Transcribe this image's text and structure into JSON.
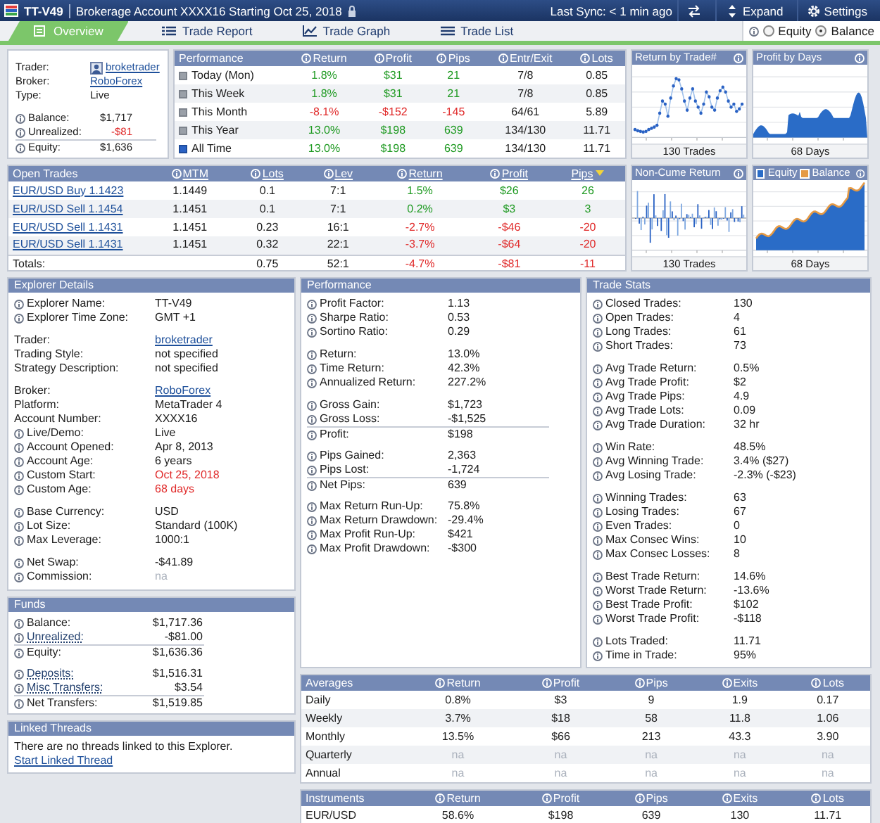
{
  "header": {
    "title": "TT-V49",
    "subtitle": "Brokerage Account XXXX16 Starting Oct 25, 2018",
    "sync": "Last Sync: < 1 min ago",
    "buttons": [
      {
        "kind": "swap"
      },
      {
        "kind": "expand",
        "label": "Expand"
      },
      {
        "kind": "settings",
        "label": "Settings"
      }
    ]
  },
  "tabs": [
    {
      "label": "Overview",
      "kind": "overview",
      "selected": true
    },
    {
      "label": "Trade Report",
      "kind": "report",
      "selected": false
    },
    {
      "label": "Trade Graph",
      "kind": "graph",
      "selected": false
    },
    {
      "label": "Trade List",
      "kind": "list",
      "selected": false
    }
  ],
  "view_toggle": [
    {
      "label": "Equity",
      "selected": false
    },
    {
      "label": "Balance",
      "selected": true
    }
  ],
  "summary": {
    "groups": [
      [
        {
          "label": "Trader:",
          "value": "broketrader",
          "kind": "link",
          "avatar": true
        },
        {
          "label": "Broker:",
          "value": "RoboForex",
          "kind": "link"
        },
        {
          "label": "Type:",
          "value": "Live",
          "kind": "text"
        }
      ],
      [
        {
          "label": "Balance:",
          "value": "$1,717",
          "kind": "text",
          "info": true
        },
        {
          "label": "Unrealized:",
          "value": "-$81",
          "kind": "down",
          "info": true
        },
        {
          "label": "Equity:",
          "value": "$1,636",
          "kind": "text",
          "info": true,
          "total": true
        }
      ]
    ]
  },
  "performance_table": {
    "title": "Performance",
    "columns": [
      {
        "label": "Return",
        "info": true,
        "colored": true
      },
      {
        "label": "Profit",
        "info": true,
        "colored": true
      },
      {
        "label": "Pips",
        "info": true,
        "colored": true
      },
      {
        "label": "Entr/Exit",
        "info": true
      },
      {
        "label": "Lots",
        "info": true
      }
    ],
    "rows": [
      {
        "label": "Today (Mon)",
        "selected": false,
        "kind": "gain",
        "cells": [
          "1.8%",
          "$31",
          "21",
          "7/8",
          "0.85"
        ]
      },
      {
        "label": "This Week",
        "selected": false,
        "kind": "gain",
        "cells": [
          "1.8%",
          "$31",
          "21",
          "7/8",
          "0.85"
        ]
      },
      {
        "label": "This Month",
        "selected": false,
        "kind": "loss",
        "cells": [
          "-8.1%",
          "-$152",
          "-145",
          "64/61",
          "5.89"
        ]
      },
      {
        "label": "This Year",
        "selected": false,
        "kind": "gain",
        "cells": [
          "13.0%",
          "$198",
          "639",
          "134/130",
          "11.71"
        ]
      },
      {
        "label": "All Time",
        "selected": true,
        "kind": "gain",
        "cells": [
          "13.0%",
          "$198",
          "639",
          "134/130",
          "11.71"
        ]
      }
    ]
  },
  "open_trades": {
    "title": "Open Trades",
    "columns": [
      {
        "label": "MTM",
        "info": true,
        "link": true
      },
      {
        "label": "Lots",
        "info": true,
        "link": true
      },
      {
        "label": "Lev",
        "info": true,
        "link": true
      },
      {
        "label": "Return",
        "info": true,
        "link": true,
        "colored": true
      },
      {
        "label": "Profit",
        "info": true,
        "link": true,
        "colored": true
      },
      {
        "label": "Pips",
        "link": true,
        "colored": true,
        "sorted": true
      }
    ],
    "rows": [
      {
        "label": "EUR/USD Buy 1.1423",
        "kind": "gain",
        "cells": [
          "1.1449",
          "0.1",
          "7:1",
          "1.5%",
          "$26",
          "26"
        ]
      },
      {
        "label": "EUR/USD Sell 1.1454",
        "kind": "gain",
        "cells": [
          "1.1451",
          "0.1",
          "7:1",
          "0.2%",
          "$3",
          "3"
        ]
      },
      {
        "label": "EUR/USD Sell 1.1431",
        "kind": "loss",
        "cells": [
          "1.1451",
          "0.23",
          "16:1",
          "-2.7%",
          "-$46",
          "-20"
        ]
      },
      {
        "label": "EUR/USD Sell 1.1431",
        "kind": "loss",
        "cells": [
          "1.1451",
          "0.32",
          "22:1",
          "-3.7%",
          "-$64",
          "-20"
        ]
      }
    ],
    "totals": {
      "label": "Totals:",
      "kind": "loss",
      "cells": [
        null,
        "0.75",
        "52:1",
        "-4.7%",
        "-$81",
        "-11"
      ]
    }
  },
  "charts": [
    {
      "title": "Return by Trade#",
      "kind": "scatter",
      "footer": "130 Trades"
    },
    {
      "title": "Profit by Days",
      "kind": "area",
      "footer": "68 Days"
    },
    {
      "title": "Non-Cume Return",
      "kind": "bars",
      "footer": "130 Trades"
    },
    {
      "legend": [
        {
          "label": "Equity",
          "color": "#2a6cc7"
        },
        {
          "label": "Balance",
          "color": "#e59a45"
        }
      ],
      "kind": "equity",
      "footer": "68 Days"
    }
  ],
  "explorer_details": {
    "title": "Explorer Details",
    "groups": [
      [
        {
          "label": "Explorer Name:",
          "value": "TT-V49",
          "kind": "text",
          "info": true
        },
        {
          "label": "Explorer Time Zone:",
          "value": "GMT +1",
          "kind": "text",
          "info": true
        }
      ],
      [
        {
          "label": "Trader:",
          "value": "broketrader",
          "kind": "link"
        },
        {
          "label": "Trading Style:",
          "value": "not specified",
          "kind": "text"
        },
        {
          "label": "Strategy Description:",
          "value": "not specified",
          "kind": "text"
        }
      ],
      [
        {
          "label": "Broker:",
          "value": "RoboForex",
          "kind": "link"
        },
        {
          "label": "Platform:",
          "value": "MetaTrader 4",
          "kind": "text"
        },
        {
          "label": "Account Number:",
          "value": "XXXX16",
          "kind": "text"
        },
        {
          "label": "Live/Demo:",
          "value": "Live",
          "kind": "text",
          "info": true
        },
        {
          "label": "Account Opened:",
          "value": "Apr 8, 2013",
          "kind": "text",
          "info": true
        },
        {
          "label": "Account Age:",
          "value": "6 years",
          "kind": "text",
          "info": true
        },
        {
          "label": "Custom Start:",
          "value": "Oct 25, 2018",
          "kind": "alert",
          "info": true
        },
        {
          "label": "Custom Age:",
          "value": "68 days",
          "kind": "alert",
          "info": true
        }
      ],
      [
        {
          "label": "Base Currency:",
          "value": "USD",
          "kind": "text",
          "info": true
        },
        {
          "label": "Lot Size:",
          "value": "Standard (100K)",
          "kind": "text",
          "info": true
        },
        {
          "label": "Max Leverage:",
          "value": "1000:1",
          "kind": "text",
          "info": true
        }
      ],
      [
        {
          "label": "Net Swap:",
          "value": "-$41.89",
          "kind": "text",
          "info": true
        },
        {
          "label": "Commission:",
          "value": "na",
          "kind": "na",
          "info": true
        }
      ]
    ]
  },
  "funds": {
    "title": "Funds",
    "groups": [
      [
        {
          "label": "Balance:",
          "value": "$1,717.36",
          "kind": "text",
          "info": true
        },
        {
          "label": "Unrealized:",
          "value": "-$81.00",
          "kind": "text",
          "info": true,
          "label_link": true
        },
        {
          "label": "Equity:",
          "value": "$1,636.36",
          "kind": "text",
          "info": true,
          "total": true
        }
      ],
      [
        {
          "label": "Deposits:",
          "value": "$1,516.31",
          "kind": "text",
          "info": true,
          "label_link": true
        },
        {
          "label": "Misc Transfers:",
          "value": "$3.54",
          "kind": "text",
          "info": true,
          "label_link": true
        },
        {
          "label": "Net Transfers:",
          "value": "$1,519.85",
          "kind": "text",
          "info": true,
          "total": true
        }
      ]
    ]
  },
  "linked_threads": {
    "title": "Linked Threads",
    "message": "There are no threads linked to this Explorer.",
    "link": "Start Linked Thread"
  },
  "performance": {
    "title": "Performance",
    "groups": [
      [
        {
          "label": "Profit Factor:",
          "value": "1.13",
          "kind": "text",
          "info": true
        },
        {
          "label": "Sharpe Ratio:",
          "value": "0.53",
          "kind": "text",
          "info": true
        },
        {
          "label": "Sortino Ratio:",
          "value": "0.29",
          "kind": "text",
          "info": true
        }
      ],
      [
        {
          "label": "Return:",
          "value": "13.0%",
          "kind": "text",
          "info": true
        },
        {
          "label": "Time Return:",
          "value": "42.3%",
          "kind": "text",
          "info": true
        },
        {
          "label": "Annualized Return:",
          "value": "227.2%",
          "kind": "text",
          "info": true
        }
      ],
      [
        {
          "label": "Gross Gain:",
          "value": "$1,723",
          "kind": "text",
          "info": true
        },
        {
          "label": "Gross Loss:",
          "value": "-$1,525",
          "kind": "text",
          "info": true
        },
        {
          "label": "Profit:",
          "value": "$198",
          "kind": "text",
          "info": true,
          "total": true
        }
      ],
      [
        {
          "label": "Pips Gained:",
          "value": "2,363",
          "kind": "text",
          "info": true
        },
        {
          "label": "Pips Lost:",
          "value": "-1,724",
          "kind": "text",
          "info": true
        },
        {
          "label": "Net Pips:",
          "value": "639",
          "kind": "text",
          "info": true,
          "total": true
        }
      ],
      [
        {
          "label": "Max Return Run-Up:",
          "value": "75.8%",
          "kind": "text",
          "info": true
        },
        {
          "label": "Max Return Drawdown:",
          "value": "-29.4%",
          "kind": "text",
          "info": true
        },
        {
          "label": "Max Profit Run-Up:",
          "value": "$421",
          "kind": "text",
          "info": true
        },
        {
          "label": "Max Profit Drawdown:",
          "value": "-$300",
          "kind": "text",
          "info": true
        }
      ]
    ]
  },
  "trade_stats": {
    "title": "Trade Stats",
    "groups": [
      [
        {
          "label": "Closed Trades:",
          "value": "130",
          "kind": "text",
          "info": true
        },
        {
          "label": "Open Trades:",
          "value": "4",
          "kind": "text",
          "info": true
        },
        {
          "label": "Long Trades:",
          "value": "61",
          "kind": "text",
          "info": true
        },
        {
          "label": "Short Trades:",
          "value": "73",
          "kind": "text",
          "info": true
        }
      ],
      [
        {
          "label": "Avg Trade Return:",
          "value": "0.5%",
          "kind": "text",
          "info": true
        },
        {
          "label": "Avg Trade Profit:",
          "value": "$2",
          "kind": "text",
          "info": true
        },
        {
          "label": "Avg Trade Pips:",
          "value": "4.9",
          "kind": "text",
          "info": true
        },
        {
          "label": "Avg Trade Lots:",
          "value": "0.09",
          "kind": "text",
          "info": true
        },
        {
          "label": "Avg Trade Duration:",
          "value": "32 hr",
          "kind": "text",
          "info": true
        }
      ],
      [
        {
          "label": "Win Rate:",
          "value": "48.5%",
          "kind": "text",
          "info": true
        },
        {
          "label": "Avg Winning Trade:",
          "value": "3.4% ($27)",
          "kind": "text",
          "info": true
        },
        {
          "label": "Avg Losing Trade:",
          "value": "-2.3% (-$23)",
          "kind": "text",
          "info": true
        }
      ],
      [
        {
          "label": "Winning Trades:",
          "value": "63",
          "kind": "text",
          "info": true
        },
        {
          "label": "Losing Trades:",
          "value": "67",
          "kind": "text",
          "info": true
        },
        {
          "label": "Even Trades:",
          "value": "0",
          "kind": "text",
          "info": true
        },
        {
          "label": "Max Consec Wins:",
          "value": "10",
          "kind": "text",
          "info": true
        },
        {
          "label": "Max Consec Losses:",
          "value": "8",
          "kind": "text",
          "info": true
        }
      ],
      [
        {
          "label": "Best Trade Return:",
          "value": "14.6%",
          "kind": "text",
          "info": true
        },
        {
          "label": "Worst Trade Return:",
          "value": "-13.6%",
          "kind": "text",
          "info": true
        },
        {
          "label": "Best Trade Profit:",
          "value": "$102",
          "kind": "text",
          "info": true
        },
        {
          "label": "Worst Trade Profit:",
          "value": "-$118",
          "kind": "text",
          "info": true
        }
      ],
      [
        {
          "label": "Lots Traded:",
          "value": "11.71",
          "kind": "text",
          "info": true
        },
        {
          "label": "Time in Trade:",
          "value": "95%",
          "kind": "text",
          "info": true
        }
      ]
    ]
  },
  "averages": {
    "title": "Averages",
    "columns": [
      {
        "label": "Return",
        "info": true,
        "colored": true
      },
      {
        "label": "Profit",
        "info": true,
        "colored": true
      },
      {
        "label": "Pips",
        "info": true,
        "colored": true
      },
      {
        "label": "Exits",
        "info": true,
        "colored": true
      },
      {
        "label": "Lots",
        "info": true,
        "colored": true
      }
    ],
    "rows": [
      {
        "label": "Daily",
        "kind": "plain",
        "cells": [
          "0.8%",
          "$3",
          "9",
          "1.9",
          "0.17"
        ]
      },
      {
        "label": "Weekly",
        "kind": "plain",
        "cells": [
          "3.7%",
          "$18",
          "58",
          "11.8",
          "1.06"
        ]
      },
      {
        "label": "Monthly",
        "kind": "plain",
        "cells": [
          "13.5%",
          "$66",
          "213",
          "43.3",
          "3.90"
        ]
      },
      {
        "label": "Quarterly",
        "kind": "na",
        "cells": [
          "na",
          "na",
          "na",
          "na",
          "na"
        ]
      },
      {
        "label": "Annual",
        "kind": "na",
        "cells": [
          "na",
          "na",
          "na",
          "na",
          "na"
        ]
      }
    ]
  },
  "instruments": {
    "title": "Instruments",
    "columns": [
      {
        "label": "Return",
        "info": true
      },
      {
        "label": "Profit",
        "info": true
      },
      {
        "label": "Pips",
        "info": true
      },
      {
        "label": "Exits",
        "info": true
      },
      {
        "label": "Lots",
        "info": true
      }
    ],
    "rows": [
      {
        "label": "EUR/USD",
        "cells": [
          "58.6%",
          "$198",
          "639",
          "130",
          "11.71"
        ]
      }
    ]
  }
}
